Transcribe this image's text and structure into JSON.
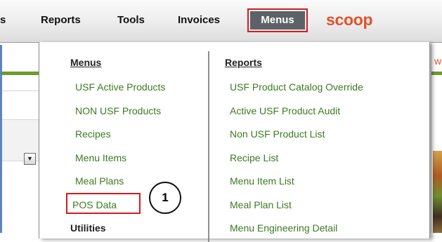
{
  "navbar": {
    "items": [
      {
        "label": "s"
      },
      {
        "label": "Reports"
      },
      {
        "label": "Tools"
      },
      {
        "label": "Invoices"
      },
      {
        "label": "Menus",
        "active": true
      }
    ],
    "brand": "scoop"
  },
  "page": {
    "right_fragment": "w"
  },
  "dropdown": {
    "left_column": {
      "heading": "Menus",
      "items": [
        {
          "label": "USF Active Products"
        },
        {
          "label": "NON USF Products"
        },
        {
          "label": "Recipes"
        },
        {
          "label": "Menu Items"
        },
        {
          "label": "Meal Plans"
        },
        {
          "label": "POS Data",
          "highlighted": true
        }
      ],
      "second_heading": "Utilities"
    },
    "right_column": {
      "heading": "Reports",
      "items": [
        {
          "label": "USF Product Catalog Override"
        },
        {
          "label": "Active USF Product Audit"
        },
        {
          "label": "Non USF Product List"
        },
        {
          "label": "Recipe List"
        },
        {
          "label": "Menu Item List"
        },
        {
          "label": "Meal Plan List"
        },
        {
          "label": "Menu Engineering Detail"
        }
      ]
    }
  },
  "annotation": {
    "step_number": "1"
  },
  "colors": {
    "link_green": "#3c7a23",
    "highlight_red": "#d9191e",
    "brand_orange": "#e2512a",
    "active_tab_gray": "#5c6267"
  }
}
